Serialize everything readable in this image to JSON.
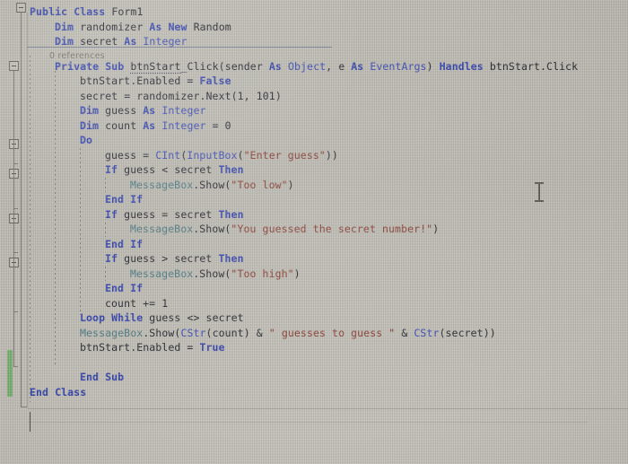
{
  "editor": {
    "language": "Visual Basic",
    "codelens": "0 references",
    "colors": {
      "background": "#b9b7ae",
      "keyword": "#2f3fae",
      "type": "#3a49b8",
      "class_name": "#4d7b84",
      "string": "#8a3a2e",
      "identifier": "#24262f",
      "codelens_text": "#6f6d67",
      "change_bar_green": "#6cab63",
      "outline_box_border": "#5d5a53"
    },
    "code_lines": [
      {
        "indent": 0,
        "text": "Public Class Form1"
      },
      {
        "indent": 1,
        "text": "Dim randomizer As New Random"
      },
      {
        "indent": 1,
        "text": "Dim secret As Integer"
      },
      {
        "indent": 1,
        "text": "Private Sub btnStart_Click(sender As Object, e As EventArgs) Handles btnStart.Click"
      },
      {
        "indent": 2,
        "text": "btnStart.Enabled = False"
      },
      {
        "indent": 2,
        "text": "secret = randomizer.Next(1, 101)"
      },
      {
        "indent": 2,
        "text": "Dim guess As Integer"
      },
      {
        "indent": 2,
        "text": "Dim count As Integer = 0"
      },
      {
        "indent": 2,
        "text": "Do"
      },
      {
        "indent": 3,
        "text": "guess = CInt(InputBox(\"Enter guess\"))"
      },
      {
        "indent": 3,
        "text": "If guess < secret Then"
      },
      {
        "indent": 4,
        "text": "MessageBox.Show(\"Too low\")"
      },
      {
        "indent": 3,
        "text": "End If"
      },
      {
        "indent": 3,
        "text": "If guess = secret Then"
      },
      {
        "indent": 4,
        "text": "MessageBox.Show(\"You guessed the secret number!\")"
      },
      {
        "indent": 3,
        "text": "End If"
      },
      {
        "indent": 3,
        "text": "If guess > secret Then"
      },
      {
        "indent": 4,
        "text": "MessageBox.Show(\"Too high\")"
      },
      {
        "indent": 3,
        "text": "End If"
      },
      {
        "indent": 3,
        "text": "count += 1"
      },
      {
        "indent": 2,
        "text": "Loop While guess <> secret"
      },
      {
        "indent": 2,
        "text": "MessageBox.Show(CStr(count) & \" guesses to guess \" & CStr(secret))"
      },
      {
        "indent": 2,
        "text": "btnStart.Enabled = True"
      },
      {
        "indent": 2,
        "text": ""
      },
      {
        "indent": 2,
        "text": "End Sub"
      },
      {
        "indent": 0,
        "text": "End Class"
      }
    ],
    "tokens": {
      "l0": [
        [
          "kw",
          "Public"
        ],
        [
          "sp",
          " "
        ],
        [
          "kw",
          "Class"
        ],
        [
          "sp",
          " "
        ],
        [
          "id",
          "Form1"
        ]
      ],
      "l1": [
        [
          "kw",
          "Dim"
        ],
        [
          "sp",
          " "
        ],
        [
          "id",
          "randomizer"
        ],
        [
          "sp",
          " "
        ],
        [
          "kw",
          "As"
        ],
        [
          "sp",
          " "
        ],
        [
          "kw",
          "New"
        ],
        [
          "sp",
          " "
        ],
        [
          "id",
          "Random"
        ]
      ],
      "l2": [
        [
          "kw",
          "Dim"
        ],
        [
          "sp",
          " "
        ],
        [
          "id",
          "secret"
        ],
        [
          "sp",
          " "
        ],
        [
          "kw",
          "As"
        ],
        [
          "sp",
          " "
        ],
        [
          "typ",
          "Integer"
        ]
      ],
      "l3": [
        [
          "kw",
          "Private"
        ],
        [
          "sp",
          " "
        ],
        [
          "kw",
          "Sub"
        ],
        [
          "sp",
          " "
        ],
        [
          "sq",
          "btnStart"
        ],
        [
          "id",
          "_Click"
        ],
        [
          "op",
          "("
        ],
        [
          "id",
          "sender"
        ],
        [
          "sp",
          " "
        ],
        [
          "kw",
          "As"
        ],
        [
          "sp",
          " "
        ],
        [
          "typ",
          "Object"
        ],
        [
          "op",
          ","
        ],
        [
          "sp",
          " "
        ],
        [
          "id",
          "e"
        ],
        [
          "sp",
          " "
        ],
        [
          "kw",
          "As"
        ],
        [
          "sp",
          " "
        ],
        [
          "typ",
          "EventArgs"
        ],
        [
          "op",
          ")"
        ],
        [
          "sp",
          " "
        ],
        [
          "kw",
          "Handles"
        ],
        [
          "sp",
          " "
        ],
        [
          "id",
          "btnStart.Click"
        ]
      ],
      "l4": [
        [
          "id",
          "btnStart.Enabled"
        ],
        [
          "sp",
          " "
        ],
        [
          "op",
          "="
        ],
        [
          "sp",
          " "
        ],
        [
          "kw",
          "False"
        ]
      ],
      "l5": [
        [
          "id",
          "secret"
        ],
        [
          "sp",
          " "
        ],
        [
          "op",
          "="
        ],
        [
          "sp",
          " "
        ],
        [
          "id",
          "randomizer.Next("
        ],
        [
          "num",
          "1"
        ],
        [
          "op",
          ","
        ],
        [
          "sp",
          " "
        ],
        [
          "num",
          "101"
        ],
        [
          "op",
          ")"
        ]
      ],
      "l6": [
        [
          "kw",
          "Dim"
        ],
        [
          "sp",
          " "
        ],
        [
          "id",
          "guess"
        ],
        [
          "sp",
          " "
        ],
        [
          "kw",
          "As"
        ],
        [
          "sp",
          " "
        ],
        [
          "typ",
          "Integer"
        ]
      ],
      "l7": [
        [
          "kw",
          "Dim"
        ],
        [
          "sp",
          " "
        ],
        [
          "id",
          "count"
        ],
        [
          "sp",
          " "
        ],
        [
          "kw",
          "As"
        ],
        [
          "sp",
          " "
        ],
        [
          "typ",
          "Integer"
        ],
        [
          "sp",
          " "
        ],
        [
          "op",
          "="
        ],
        [
          "sp",
          " "
        ],
        [
          "num",
          "0"
        ]
      ],
      "l8": [
        [
          "kw",
          "Do"
        ]
      ],
      "l9": [
        [
          "id",
          "guess"
        ],
        [
          "sp",
          " "
        ],
        [
          "op",
          "="
        ],
        [
          "sp",
          " "
        ],
        [
          "typ",
          "CInt"
        ],
        [
          "op",
          "("
        ],
        [
          "typ",
          "InputBox"
        ],
        [
          "op",
          "("
        ],
        [
          "str",
          "\"Enter guess\""
        ],
        [
          "op",
          "))"
        ]
      ],
      "l10": [
        [
          "kw",
          "If"
        ],
        [
          "sp",
          " "
        ],
        [
          "id",
          "guess"
        ],
        [
          "sp",
          " "
        ],
        [
          "op",
          "<"
        ],
        [
          "sp",
          " "
        ],
        [
          "id",
          "secret"
        ],
        [
          "sp",
          " "
        ],
        [
          "kw",
          "Then"
        ]
      ],
      "l11": [
        [
          "cls",
          "MessageBox"
        ],
        [
          "op",
          "."
        ],
        [
          "id",
          "Show"
        ],
        [
          "op",
          "("
        ],
        [
          "str",
          "\"Too low\""
        ],
        [
          "op",
          ")"
        ]
      ],
      "l12": [
        [
          "kw",
          "End"
        ],
        [
          "sp",
          " "
        ],
        [
          "kw",
          "If"
        ]
      ],
      "l13": [
        [
          "kw",
          "If"
        ],
        [
          "sp",
          " "
        ],
        [
          "id",
          "guess"
        ],
        [
          "sp",
          " "
        ],
        [
          "op",
          "="
        ],
        [
          "sp",
          " "
        ],
        [
          "id",
          "secret"
        ],
        [
          "sp",
          " "
        ],
        [
          "kw",
          "Then"
        ]
      ],
      "l14": [
        [
          "cls",
          "MessageBox"
        ],
        [
          "op",
          "."
        ],
        [
          "id",
          "Show"
        ],
        [
          "op",
          "("
        ],
        [
          "str",
          "\"You guessed the secret number!\""
        ],
        [
          "op",
          ")"
        ]
      ],
      "l15": [
        [
          "kw",
          "End"
        ],
        [
          "sp",
          " "
        ],
        [
          "kw",
          "If"
        ]
      ],
      "l16": [
        [
          "kw",
          "If"
        ],
        [
          "sp",
          " "
        ],
        [
          "id",
          "guess"
        ],
        [
          "sp",
          " "
        ],
        [
          "op",
          ">"
        ],
        [
          "sp",
          " "
        ],
        [
          "id",
          "secret"
        ],
        [
          "sp",
          " "
        ],
        [
          "kw",
          "Then"
        ]
      ],
      "l17": [
        [
          "cls",
          "MessageBox"
        ],
        [
          "op",
          "."
        ],
        [
          "id",
          "Show"
        ],
        [
          "op",
          "("
        ],
        [
          "str",
          "\"Too high\""
        ],
        [
          "op",
          ")"
        ]
      ],
      "l18": [
        [
          "kw",
          "End"
        ],
        [
          "sp",
          " "
        ],
        [
          "kw",
          "If"
        ]
      ],
      "l19": [
        [
          "id",
          "count"
        ],
        [
          "sp",
          " "
        ],
        [
          "op",
          "+="
        ],
        [
          "sp",
          " "
        ],
        [
          "num",
          "1"
        ]
      ],
      "l20": [
        [
          "kw",
          "Loop"
        ],
        [
          "sp",
          " "
        ],
        [
          "kw",
          "While"
        ],
        [
          "sp",
          " "
        ],
        [
          "id",
          "guess"
        ],
        [
          "sp",
          " "
        ],
        [
          "op",
          "<>"
        ],
        [
          "sp",
          " "
        ],
        [
          "id",
          "secret"
        ]
      ],
      "l21": [
        [
          "cls",
          "MessageBox"
        ],
        [
          "op",
          "."
        ],
        [
          "id",
          "Show"
        ],
        [
          "op",
          "("
        ],
        [
          "typ",
          "CStr"
        ],
        [
          "op",
          "("
        ],
        [
          "id",
          "count"
        ],
        [
          "op",
          ")"
        ],
        [
          "sp",
          " "
        ],
        [
          "op",
          "&"
        ],
        [
          "sp",
          " "
        ],
        [
          "str",
          "\" guesses to guess \""
        ],
        [
          "sp",
          " "
        ],
        [
          "op",
          "&"
        ],
        [
          "sp",
          " "
        ],
        [
          "typ",
          "CStr"
        ],
        [
          "op",
          "("
        ],
        [
          "id",
          "secret"
        ],
        [
          "op",
          "))"
        ]
      ],
      "l22": [
        [
          "id",
          "btnStart.Enabled"
        ],
        [
          "sp",
          " "
        ],
        [
          "op",
          "="
        ],
        [
          "sp",
          " "
        ],
        [
          "kw",
          "True"
        ]
      ],
      "l23": [],
      "l24": [
        [
          "kw",
          "End"
        ],
        [
          "sp",
          " "
        ],
        [
          "kw",
          "Sub"
        ]
      ],
      "l25": [
        [
          "kw",
          "End"
        ],
        [
          "sp",
          " "
        ],
        [
          "kw",
          "Class"
        ]
      ]
    }
  }
}
